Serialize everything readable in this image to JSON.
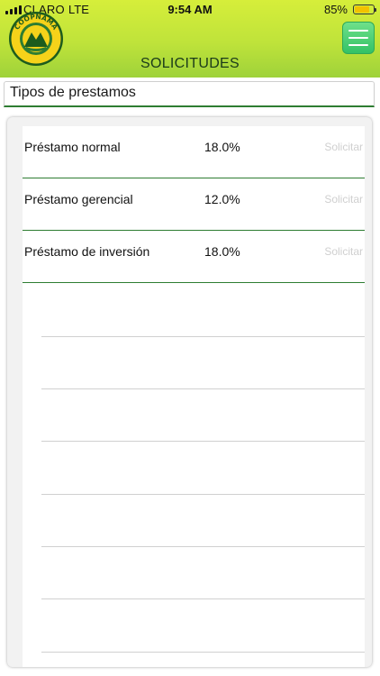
{
  "status_bar": {
    "carrier": "CLARO",
    "network": "LTE",
    "time": "9:54 AM",
    "battery_percent": "85%",
    "battery_color": "#f2c200"
  },
  "header": {
    "logo_icon": "coopnama-logo",
    "logo_text": "COOPNAMA",
    "title": "SOLICITUDES",
    "menu_icon": "hamburger-menu-icon",
    "accent_color": "#9ed23a"
  },
  "section": {
    "title": "Tipos de prestamos"
  },
  "loans": [
    {
      "name": "Préstamo normal",
      "rate": "18.0%",
      "action": "Solicitar"
    },
    {
      "name": "Préstamo gerencial",
      "rate": "12.0%",
      "action": "Solicitar"
    },
    {
      "name": "Préstamo de inversión",
      "rate": "18.0%",
      "action": "Solicitar"
    }
  ]
}
